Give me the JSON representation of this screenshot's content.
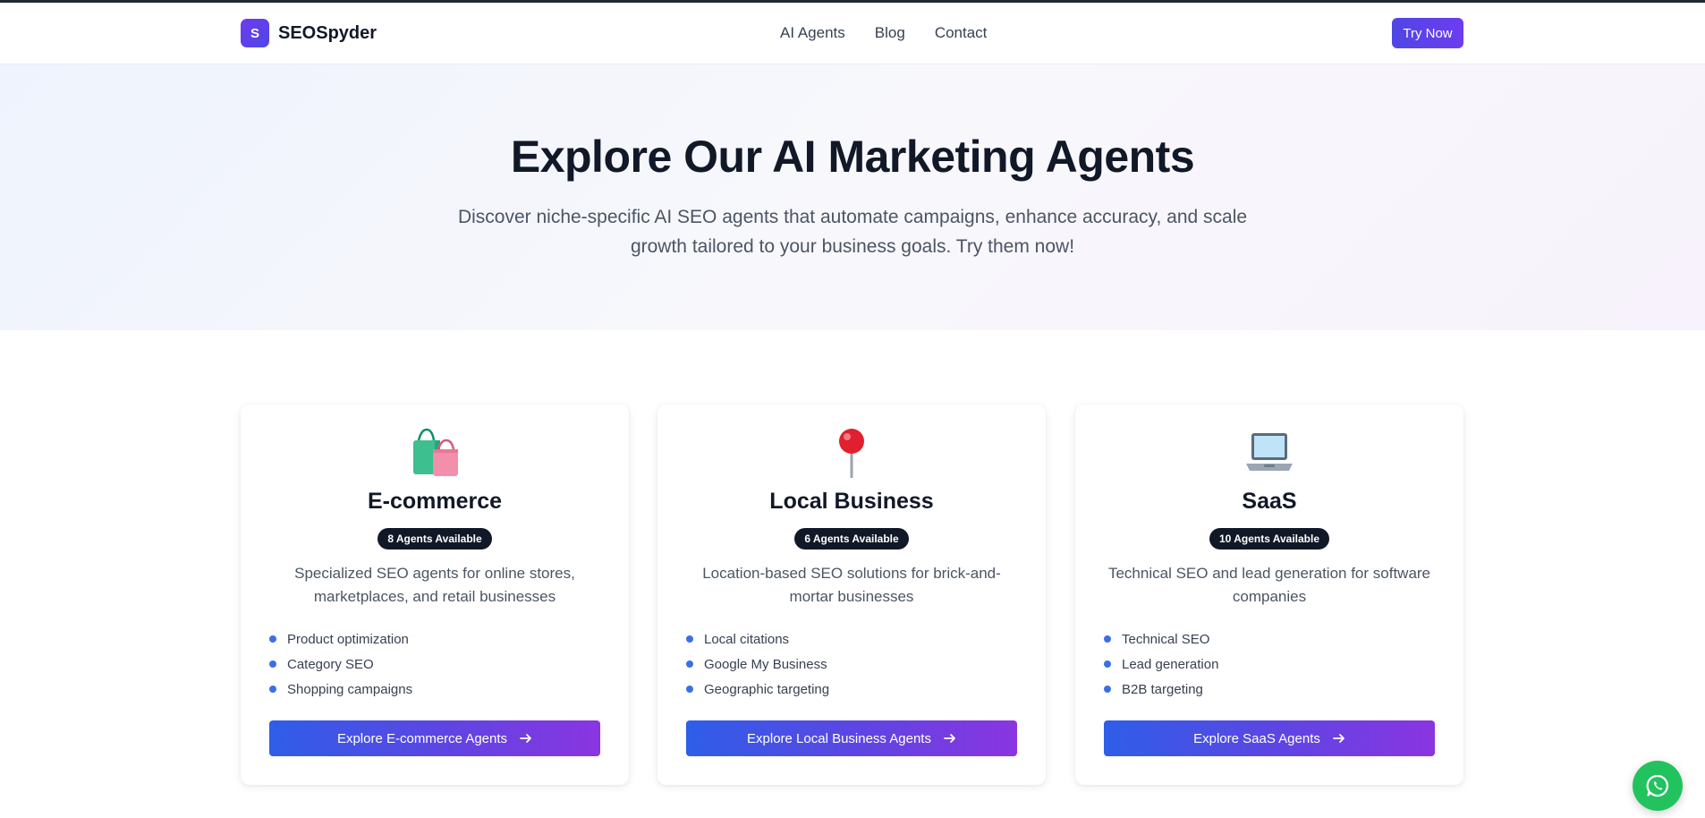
{
  "header": {
    "brand_initial": "S",
    "brand_name": "SEOSpyder",
    "nav": [
      "AI Agents",
      "Blog",
      "Contact"
    ],
    "cta": "Try Now"
  },
  "hero": {
    "title": "Explore Our AI Marketing Agents",
    "subtitle": "Discover niche-specific AI SEO agents that automate campaigns, enhance accuracy, and scale growth tailored to your business goals. Try them now!"
  },
  "cards": [
    {
      "icon": "shopping-bags-icon",
      "title": "E-commerce",
      "badge": "8 Agents Available",
      "description": "Specialized SEO agents for online stores, marketplaces, and retail businesses",
      "features": [
        "Product optimization",
        "Category SEO",
        "Shopping campaigns"
      ],
      "button": "Explore E-commerce Agents"
    },
    {
      "icon": "map-pin-icon",
      "title": "Local Business",
      "badge": "6 Agents Available",
      "description": "Location-based SEO solutions for brick-and-mortar businesses",
      "features": [
        "Local citations",
        "Google My Business",
        "Geographic targeting"
      ],
      "button": "Explore Local Business Agents"
    },
    {
      "icon": "laptop-icon",
      "title": "SaaS",
      "badge": "10 Agents Available",
      "description": "Technical SEO and lead generation for software companies",
      "features": [
        "Technical SEO",
        "Lead generation",
        "B2B targeting"
      ],
      "button": "Explore SaaS Agents"
    }
  ],
  "floating": {
    "icon": "whatsapp-icon"
  },
  "colors": {
    "brand": "#6d3cf0",
    "button_gradient_start": "#2e5ee8",
    "button_gradient_end": "#8a35e0",
    "bullet": "#3b6fe6",
    "whatsapp": "#22c35e"
  }
}
